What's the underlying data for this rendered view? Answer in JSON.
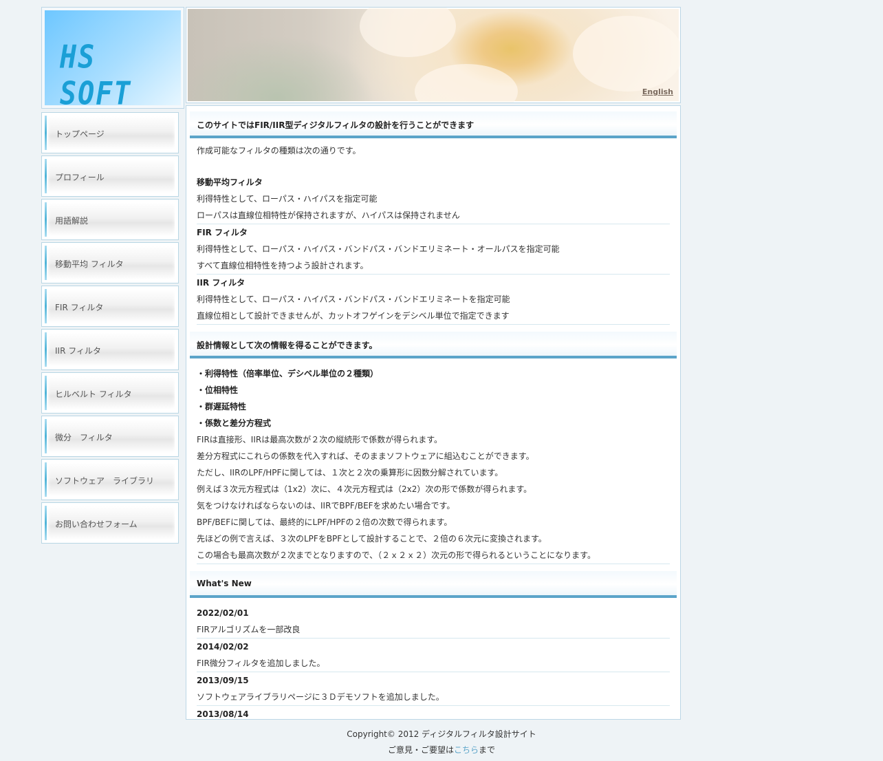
{
  "logo": {
    "text": "HS SOFT"
  },
  "header": {
    "english_link": "English"
  },
  "nav": {
    "items": [
      {
        "label": "トップページ"
      },
      {
        "label": "プロフィール"
      },
      {
        "label": "用語解説"
      },
      {
        "label": "移動平均 フィルタ"
      },
      {
        "label": "FIR フィルタ"
      },
      {
        "label": "IIR フィルタ"
      },
      {
        "label": "ヒルベルト フィルタ"
      },
      {
        "label": "微分　フィルタ"
      },
      {
        "label": "ソフトウェア　ライブラリ"
      },
      {
        "label": "お問い合わせフォーム"
      }
    ]
  },
  "section1": {
    "title": "このサイトではFIR/IIR型ディジタルフィルタの設計を行うことができます",
    "intro": "作成可能なフィルタの種類は次の通りです。",
    "filters": [
      {
        "name": "移動平均フィルタ",
        "line1": "利得特性として、ローパス・ハイパスを指定可能",
        "line2": "ローパスは直線位相特性が保持されますが、ハイパスは保持されません"
      },
      {
        "name": "FIR フィルタ",
        "line1": "利得特性として、ローパス・ハイパス・バンドパス・バンドエリミネート・オールパスを指定可能",
        "line2": "すべて直線位相特性を持つよう設計されます。"
      },
      {
        "name": "IIR フィルタ",
        "line1": "利得特性として、ローパス・ハイパス・バンドパス・バンドエリミネートを指定可能",
        "line2": "直線位相として設計できませんが、カットオフゲインをデシベル単位で指定できます"
      }
    ]
  },
  "section2": {
    "title": "設計情報として次の情報を得ることができます。",
    "bullets": [
      "・利得特性（倍率単位、デシベル単位の２種類）",
      "・位相特性",
      "・群遅延特性",
      "・係数と差分方程式"
    ],
    "lines": [
      "FIRは直接形、IIRは最高次数が２次の縦続形で係数が得られます。",
      "差分方程式にこれらの係数を代入すれば、そのままソフトウェアに組込むことができます。",
      "ただし、IIRのLPF/HPFに関しては、１次と２次の乗算形に因数分解されています。",
      "例えば３次元方程式は（1x2）次に、４次元方程式は（2x2）次の形で係数が得られます。",
      "気をつけなければならないのは、IIRでBPF/BEFを求めたい場合です。",
      "BPF/BEFに関しては、最終的にLPF/HPFの２倍の次数で得られます。",
      "先ほどの例で言えば、３次のLPFをBPFとして設計することで、２倍の６次元に変換されます。",
      "この場合も最高次数が２次までとなりますので、（２ｘ２ｘ２）次元の形で得られるということになります。"
    ]
  },
  "news": {
    "title": "What's New",
    "items": [
      {
        "date": "2022/02/01",
        "text": "FIRアルゴリズムを一部改良"
      },
      {
        "date": "2014/02/02",
        "text": "FIR微分フィルタを追加しました。"
      },
      {
        "date": "2013/09/15",
        "text": "ソフトウェアライブラリページに３Ｄデモソフトを追加しました。"
      },
      {
        "date": "2013/08/14",
        "text": ""
      }
    ]
  },
  "footer": {
    "copyright": "Copyright© 2012 ディジタルフィルタ設計サイト",
    "feedback_prefix": "ご意見・ご要望は",
    "feedback_link": "こちら",
    "feedback_suffix": "まで"
  }
}
